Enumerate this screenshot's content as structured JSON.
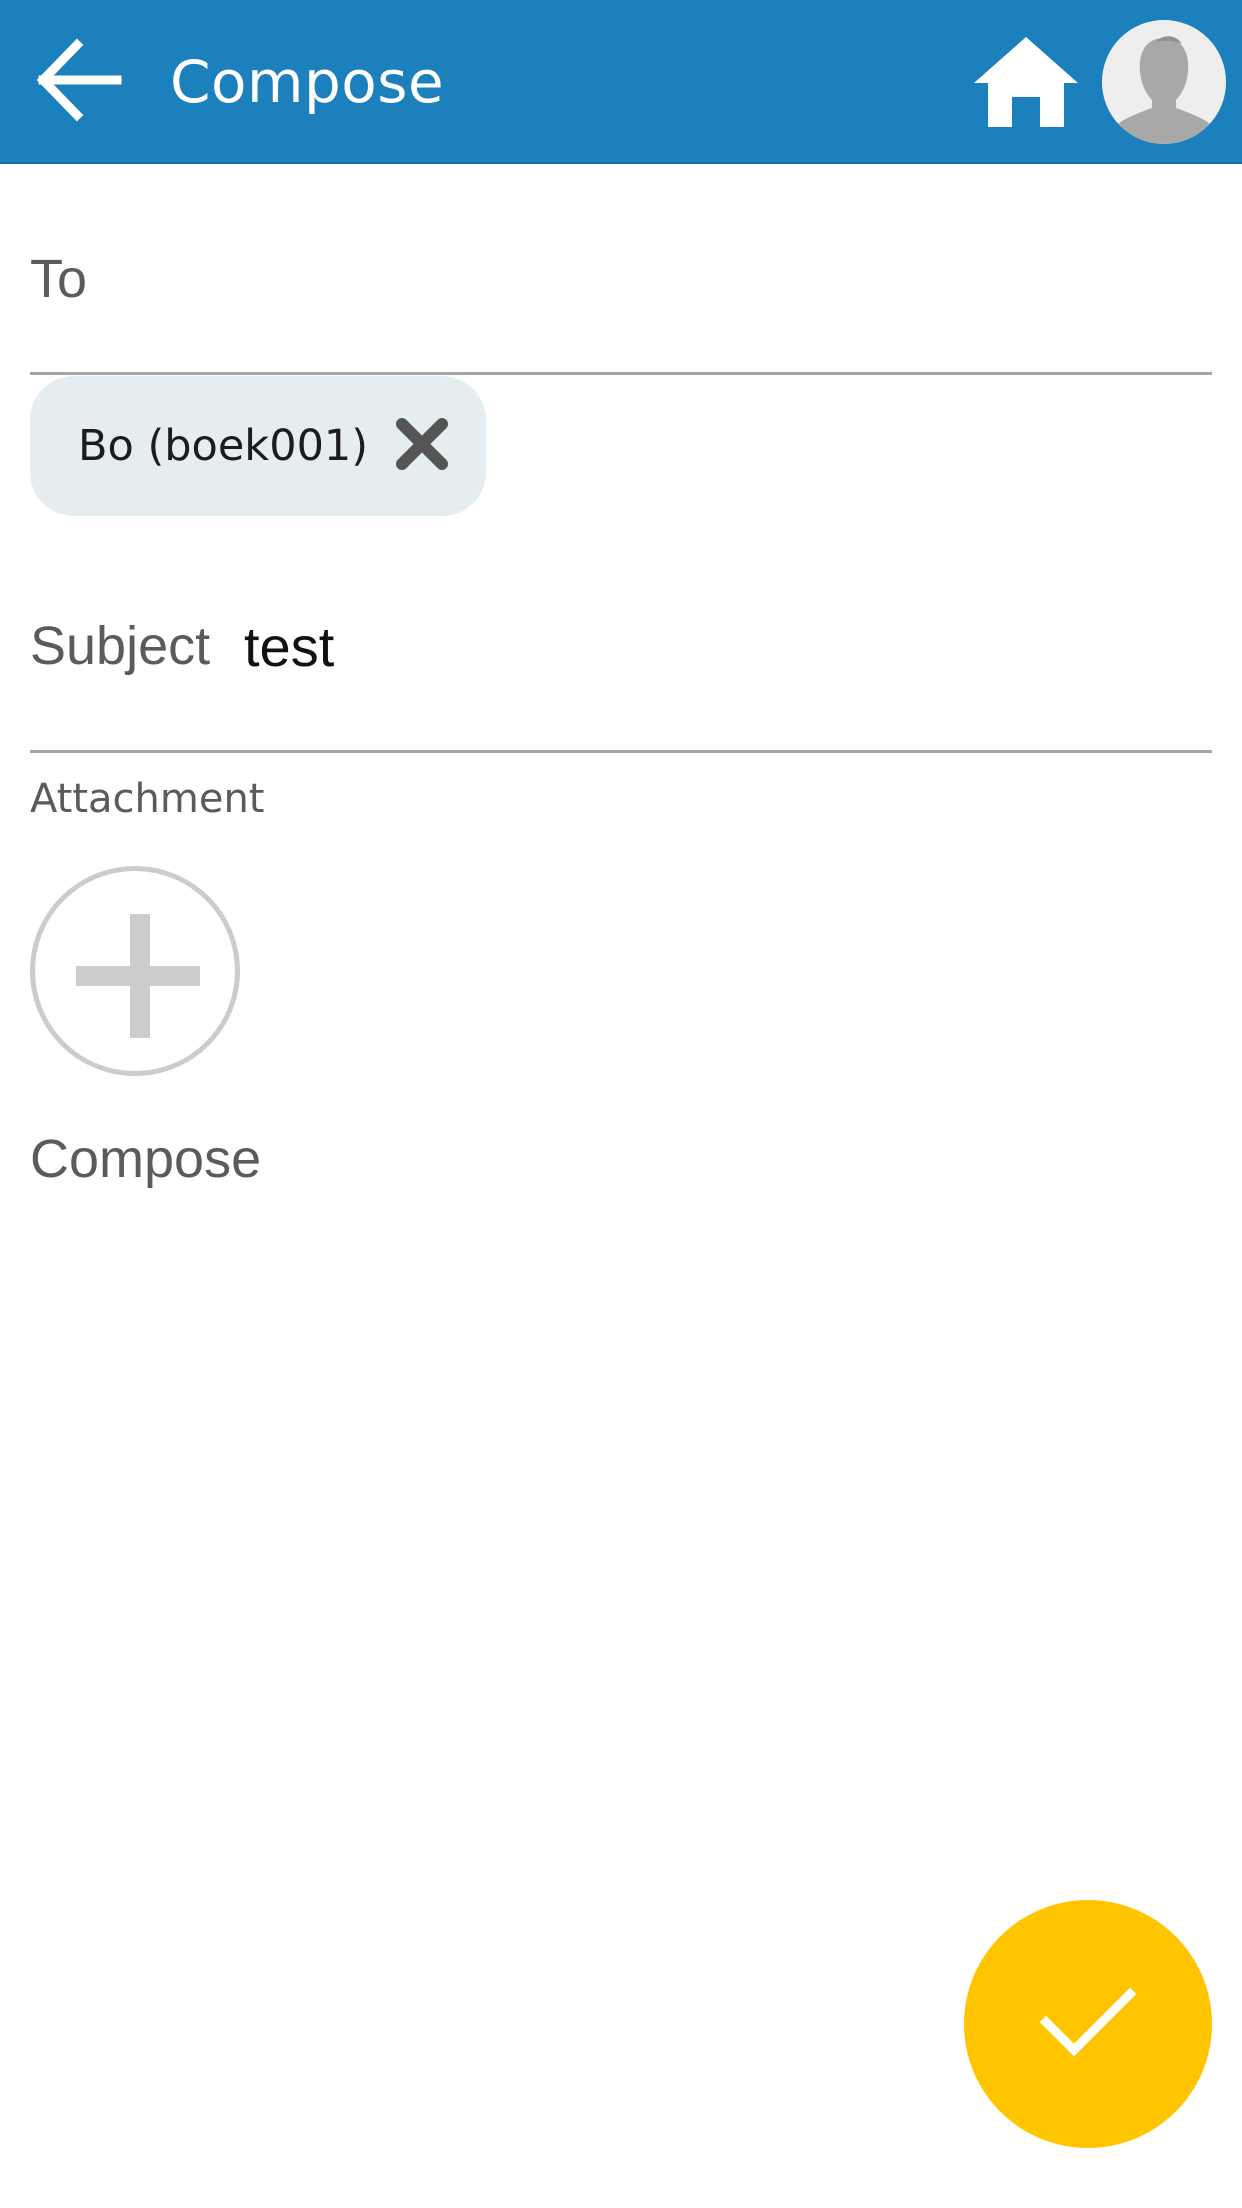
{
  "header": {
    "title": "Compose",
    "back_icon": "arrow-back-icon",
    "home_icon": "home-icon",
    "avatar_icon": "user-silhouette-icon",
    "background_color": "#1b80bc"
  },
  "form": {
    "to": {
      "label": "To",
      "recipients": [
        {
          "label": "Bo (boek001)",
          "remove_icon": "close-icon"
        }
      ]
    },
    "subject": {
      "label": "Subject",
      "value": "test"
    },
    "attachment": {
      "label": "Attachment",
      "add_icon": "plus-icon"
    },
    "compose": {
      "label": "Compose",
      "value": ""
    }
  },
  "fab": {
    "icon": "check-icon",
    "color": "#ffc600"
  }
}
